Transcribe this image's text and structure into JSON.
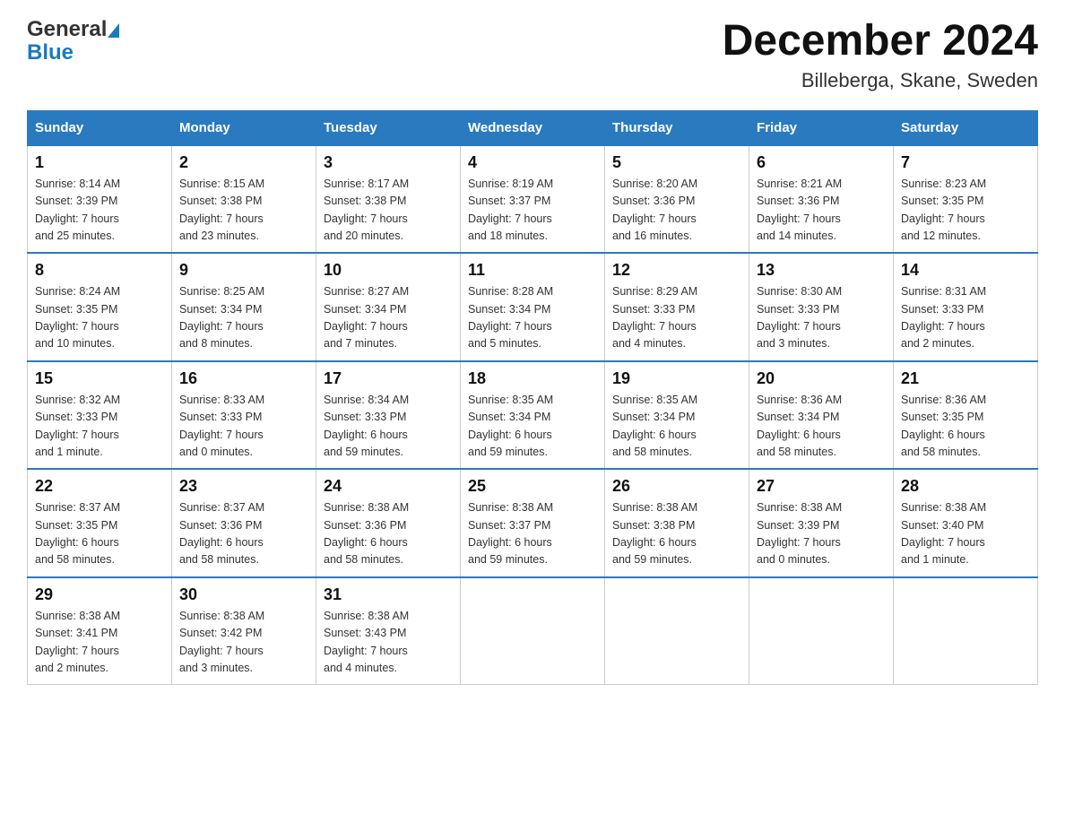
{
  "logo": {
    "text_general": "General",
    "text_blue": "Blue"
  },
  "title": "December 2024",
  "subtitle": "Billeberga, Skane, Sweden",
  "weekdays": [
    "Sunday",
    "Monday",
    "Tuesday",
    "Wednesday",
    "Thursday",
    "Friday",
    "Saturday"
  ],
  "weeks": [
    [
      {
        "day": "1",
        "sunrise": "8:14 AM",
        "sunset": "3:39 PM",
        "daylight": "7 hours and 25 minutes."
      },
      {
        "day": "2",
        "sunrise": "8:15 AM",
        "sunset": "3:38 PM",
        "daylight": "7 hours and 23 minutes."
      },
      {
        "day": "3",
        "sunrise": "8:17 AM",
        "sunset": "3:38 PM",
        "daylight": "7 hours and 20 minutes."
      },
      {
        "day": "4",
        "sunrise": "8:19 AM",
        "sunset": "3:37 PM",
        "daylight": "7 hours and 18 minutes."
      },
      {
        "day": "5",
        "sunrise": "8:20 AM",
        "sunset": "3:36 PM",
        "daylight": "7 hours and 16 minutes."
      },
      {
        "day": "6",
        "sunrise": "8:21 AM",
        "sunset": "3:36 PM",
        "daylight": "7 hours and 14 minutes."
      },
      {
        "day": "7",
        "sunrise": "8:23 AM",
        "sunset": "3:35 PM",
        "daylight": "7 hours and 12 minutes."
      }
    ],
    [
      {
        "day": "8",
        "sunrise": "8:24 AM",
        "sunset": "3:35 PM",
        "daylight": "7 hours and 10 minutes."
      },
      {
        "day": "9",
        "sunrise": "8:25 AM",
        "sunset": "3:34 PM",
        "daylight": "7 hours and 8 minutes."
      },
      {
        "day": "10",
        "sunrise": "8:27 AM",
        "sunset": "3:34 PM",
        "daylight": "7 hours and 7 minutes."
      },
      {
        "day": "11",
        "sunrise": "8:28 AM",
        "sunset": "3:34 PM",
        "daylight": "7 hours and 5 minutes."
      },
      {
        "day": "12",
        "sunrise": "8:29 AM",
        "sunset": "3:33 PM",
        "daylight": "7 hours and 4 minutes."
      },
      {
        "day": "13",
        "sunrise": "8:30 AM",
        "sunset": "3:33 PM",
        "daylight": "7 hours and 3 minutes."
      },
      {
        "day": "14",
        "sunrise": "8:31 AM",
        "sunset": "3:33 PM",
        "daylight": "7 hours and 2 minutes."
      }
    ],
    [
      {
        "day": "15",
        "sunrise": "8:32 AM",
        "sunset": "3:33 PM",
        "daylight": "7 hours and 1 minute."
      },
      {
        "day": "16",
        "sunrise": "8:33 AM",
        "sunset": "3:33 PM",
        "daylight": "7 hours and 0 minutes."
      },
      {
        "day": "17",
        "sunrise": "8:34 AM",
        "sunset": "3:33 PM",
        "daylight": "6 hours and 59 minutes."
      },
      {
        "day": "18",
        "sunrise": "8:35 AM",
        "sunset": "3:34 PM",
        "daylight": "6 hours and 59 minutes."
      },
      {
        "day": "19",
        "sunrise": "8:35 AM",
        "sunset": "3:34 PM",
        "daylight": "6 hours and 58 minutes."
      },
      {
        "day": "20",
        "sunrise": "8:36 AM",
        "sunset": "3:34 PM",
        "daylight": "6 hours and 58 minutes."
      },
      {
        "day": "21",
        "sunrise": "8:36 AM",
        "sunset": "3:35 PM",
        "daylight": "6 hours and 58 minutes."
      }
    ],
    [
      {
        "day": "22",
        "sunrise": "8:37 AM",
        "sunset": "3:35 PM",
        "daylight": "6 hours and 58 minutes."
      },
      {
        "day": "23",
        "sunrise": "8:37 AM",
        "sunset": "3:36 PM",
        "daylight": "6 hours and 58 minutes."
      },
      {
        "day": "24",
        "sunrise": "8:38 AM",
        "sunset": "3:36 PM",
        "daylight": "6 hours and 58 minutes."
      },
      {
        "day": "25",
        "sunrise": "8:38 AM",
        "sunset": "3:37 PM",
        "daylight": "6 hours and 59 minutes."
      },
      {
        "day": "26",
        "sunrise": "8:38 AM",
        "sunset": "3:38 PM",
        "daylight": "6 hours and 59 minutes."
      },
      {
        "day": "27",
        "sunrise": "8:38 AM",
        "sunset": "3:39 PM",
        "daylight": "7 hours and 0 minutes."
      },
      {
        "day": "28",
        "sunrise": "8:38 AM",
        "sunset": "3:40 PM",
        "daylight": "7 hours and 1 minute."
      }
    ],
    [
      {
        "day": "29",
        "sunrise": "8:38 AM",
        "sunset": "3:41 PM",
        "daylight": "7 hours and 2 minutes."
      },
      {
        "day": "30",
        "sunrise": "8:38 AM",
        "sunset": "3:42 PM",
        "daylight": "7 hours and 3 minutes."
      },
      {
        "day": "31",
        "sunrise": "8:38 AM",
        "sunset": "3:43 PM",
        "daylight": "7 hours and 4 minutes."
      },
      null,
      null,
      null,
      null
    ]
  ]
}
